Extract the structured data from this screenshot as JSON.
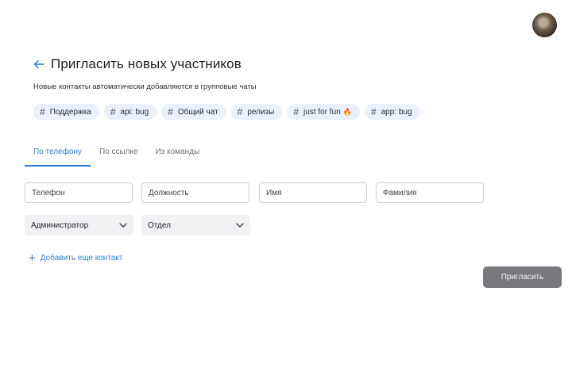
{
  "header": {
    "title": "Пригласить новых участников",
    "subtitle": "Новые контакты автоматически добавляются в групповые чаты"
  },
  "chats": [
    {
      "label": "Поддержка",
      "icon": "hash-icon"
    },
    {
      "label": "api: bug",
      "icon": "hash-icon"
    },
    {
      "label": "Общий чат",
      "icon": "hash-icon"
    },
    {
      "label": "релизы",
      "icon": "hash-icon"
    },
    {
      "label": "just for fun",
      "icon": "hash-icon",
      "emoji": "🔥"
    },
    {
      "label": "app: bug",
      "icon": "hash-icon"
    }
  ],
  "tabs": [
    {
      "label": "По телефону",
      "active": true
    },
    {
      "label": "По ссылке",
      "active": false
    },
    {
      "label": "Из команды",
      "active": false
    }
  ],
  "form": {
    "phone_placeholder": "Телефон",
    "position_placeholder": "Должность",
    "first_name_placeholder": "Имя",
    "last_name_placeholder": "Фамилия",
    "role_value": "Администратор",
    "department_value": "Отдел"
  },
  "add_contact_label": "Добавить еще контакт",
  "invite_button": "Пригласить",
  "colors": {
    "accent": "#2e7ad1",
    "chip_bg": "#e9f1fb",
    "button_bg": "#77797c"
  }
}
